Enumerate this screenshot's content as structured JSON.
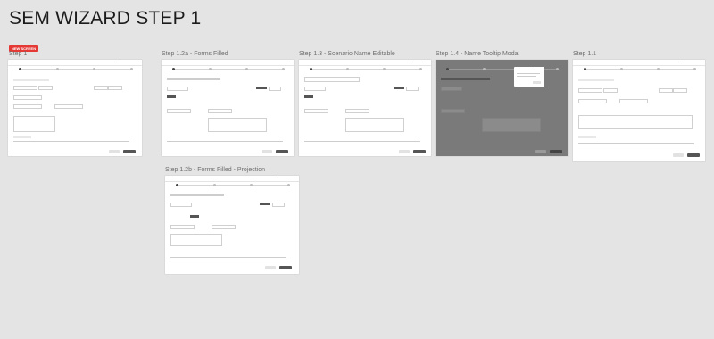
{
  "page_title": "SEM WIZARD STEP 1",
  "badge": "NEW SCREEN",
  "frames": [
    {
      "id": "f1",
      "label": "Step 1",
      "highlight": true
    },
    {
      "id": "f2",
      "label": "Step 1.2a - Forms Filled",
      "highlight": false
    },
    {
      "id": "f3",
      "label": "Step 1.3 - Scenario Name Editable",
      "highlight": false
    },
    {
      "id": "f4",
      "label": "Step 1.4 - Name Tooltip Modal",
      "highlight": false
    },
    {
      "id": "f5",
      "label": "Step 1.1",
      "highlight": false
    },
    {
      "id": "f6",
      "label": "Step 1.2b - Forms Filled - Projection",
      "highlight": false
    }
  ],
  "colors": {
    "background": "#e4e4e4",
    "badge": "#e53935",
    "label": "#6e6e6e",
    "primary_button": "#555555"
  }
}
